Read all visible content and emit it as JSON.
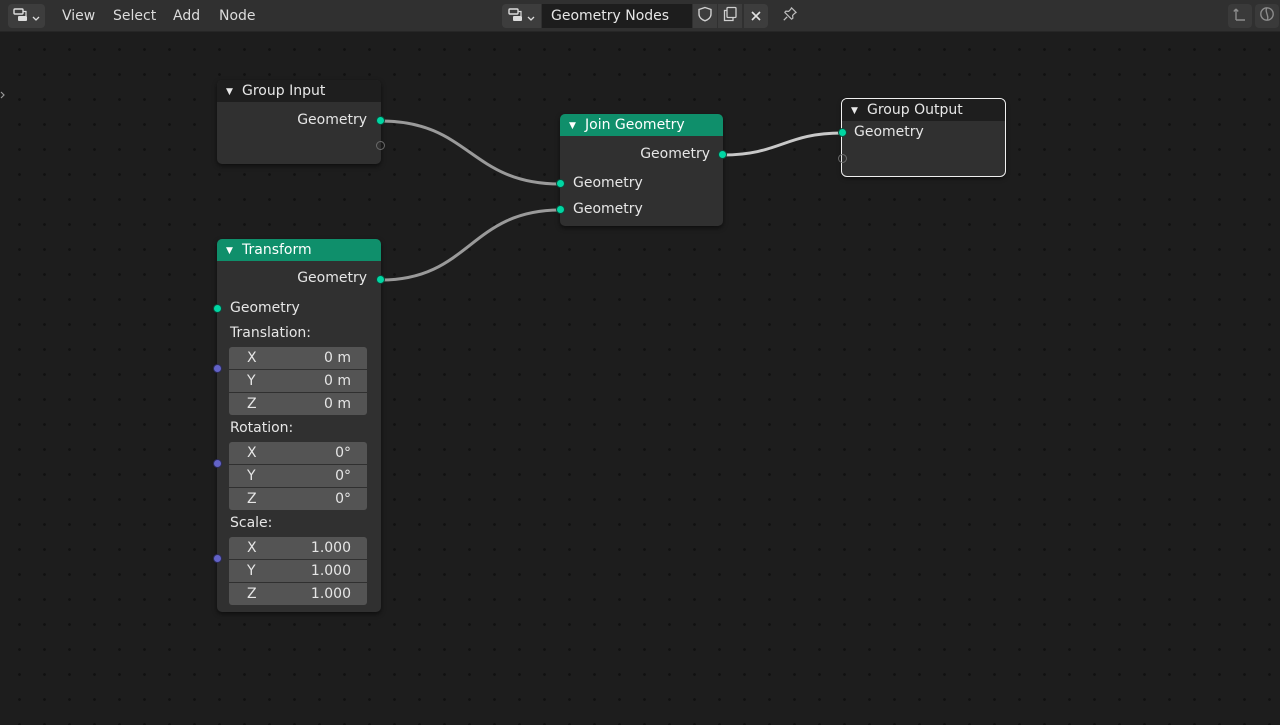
{
  "header": {
    "menu": [
      "View",
      "Select",
      "Add",
      "Node"
    ],
    "node_tree_name": "Geometry Nodes"
  },
  "nodes": {
    "group_input": {
      "title": "Group Input",
      "outputs": [
        "Geometry"
      ]
    },
    "join_geometry": {
      "title": "Join Geometry",
      "outputs": [
        "Geometry"
      ],
      "inputs": [
        "Geometry",
        "Geometry"
      ]
    },
    "group_output": {
      "title": "Group Output",
      "inputs": [
        "Geometry"
      ]
    },
    "transform": {
      "title": "Transform",
      "output": "Geometry",
      "input": "Geometry",
      "translation": {
        "label": "Translation:",
        "fields": [
          {
            "axis": "X",
            "value": "0 m"
          },
          {
            "axis": "Y",
            "value": "0 m"
          },
          {
            "axis": "Z",
            "value": "0 m"
          }
        ]
      },
      "rotation": {
        "label": "Rotation:",
        "fields": [
          {
            "axis": "X",
            "value": "0°"
          },
          {
            "axis": "Y",
            "value": "0°"
          },
          {
            "axis": "Z",
            "value": "0°"
          }
        ]
      },
      "scale": {
        "label": "Scale:",
        "fields": [
          {
            "axis": "X",
            "value": "1.000"
          },
          {
            "axis": "Y",
            "value": "1.000"
          },
          {
            "axis": "Z",
            "value": "1.000"
          }
        ]
      }
    }
  },
  "colors": {
    "geometry_socket": "#00d6a3",
    "vector_socket": "#6363c7",
    "geometry_node_header": "#0f8f6b",
    "link": "#9a9a9a"
  }
}
